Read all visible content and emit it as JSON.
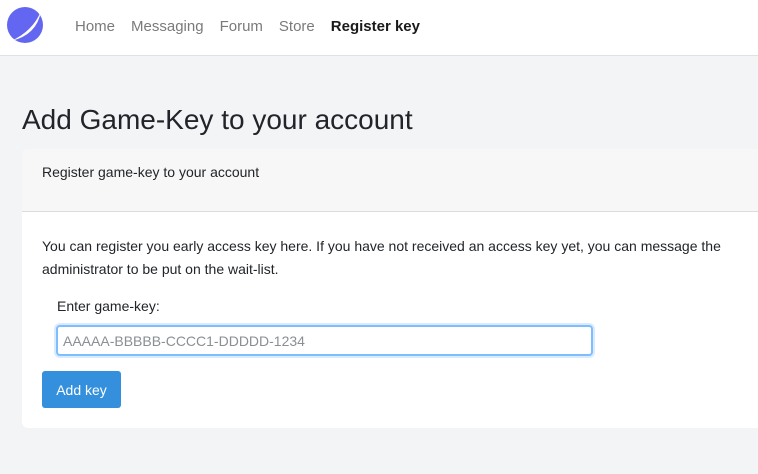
{
  "navbar": {
    "items": [
      {
        "label": "Home",
        "active": false
      },
      {
        "label": "Messaging",
        "active": false
      },
      {
        "label": "Forum",
        "active": false
      },
      {
        "label": "Store",
        "active": false
      },
      {
        "label": "Register key",
        "active": true
      }
    ]
  },
  "page": {
    "title": "Add Game-Key to your account"
  },
  "card": {
    "header": "Register game-key to your account",
    "description": "You can register you early access key here. If you have not received an access key yet, you can message the administrator to be put on the wait-list.",
    "field_label": "Enter game-key:",
    "input": {
      "value": "",
      "placeholder": "AAAAA-BBBBB-CCCC1-DDDDD-1234"
    },
    "submit_label": "Add key"
  },
  "colors": {
    "accent": "#3490dc",
    "logo": "#6366f1",
    "focus_border": "#80bdff"
  }
}
